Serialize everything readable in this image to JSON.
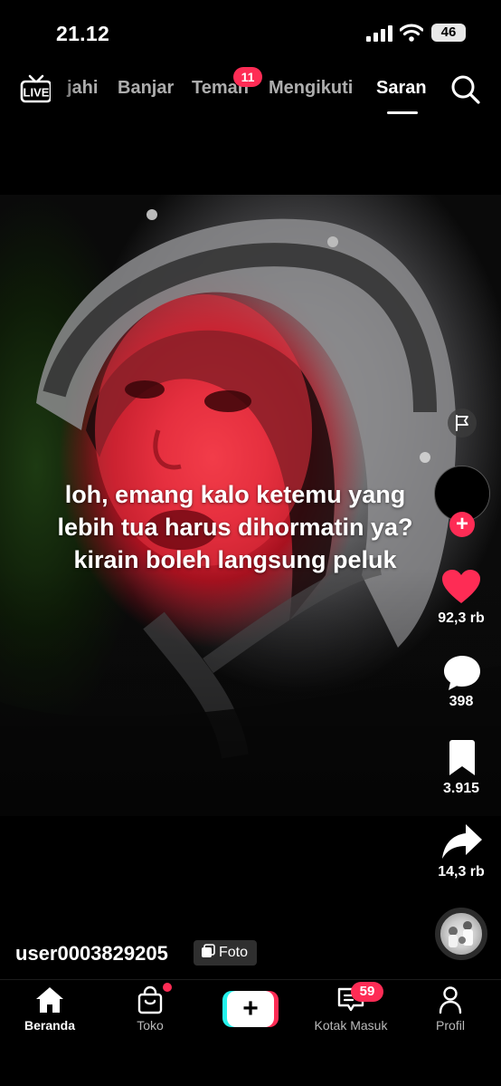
{
  "status_bar": {
    "time": "21.12",
    "battery": "46"
  },
  "top_nav": {
    "tabs": [
      "jahi",
      "Banjar",
      "Teman",
      "Mengikuti",
      "Saran"
    ],
    "active_tab": "Saran",
    "teman_badge": "11"
  },
  "post": {
    "caption": "loh, emang kalo ketemu yang lebih tua harus dihormatin ya? kirain boleh langsung peluk",
    "username": "user0003829205",
    "media_type": "Foto",
    "likes": "92,3 rb",
    "comments": "398",
    "bookmarks": "3.915",
    "shares": "14,3 rb"
  },
  "bottom_nav": {
    "items": [
      "Beranda",
      "Toko",
      "Kotak Masuk",
      "Profil"
    ],
    "inbox_badge": "59"
  },
  "colors": {
    "accent": "#fe2c55",
    "cyan": "#25f4ee",
    "background": "#000000"
  }
}
